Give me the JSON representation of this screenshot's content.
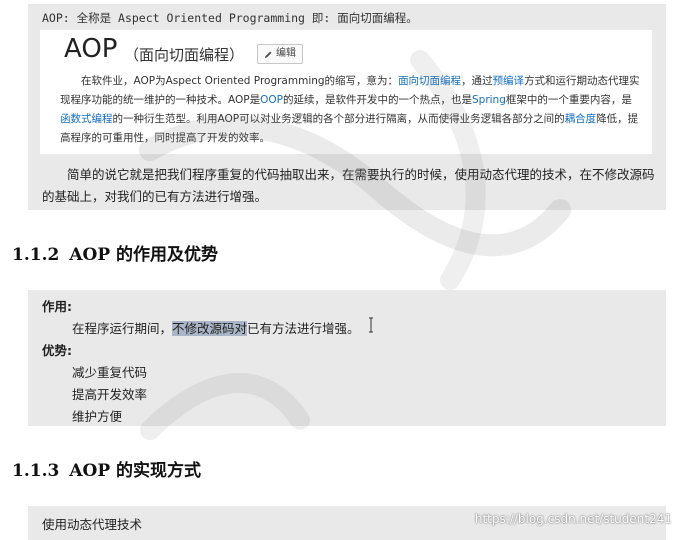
{
  "definition_line": "AOP: 全称是 Aspect Oriented Programming 即: 面向切面编程。",
  "baike": {
    "title": "AOP",
    "subtitle": "（面向切面编程）",
    "edit_label": "编辑",
    "para_parts": [
      {
        "t": "在软件业，AOP为Aspect Oriented Programming的缩写，意为：",
        "link": false
      },
      {
        "t": "面向切面编程",
        "link": true
      },
      {
        "t": "，通过",
        "link": false
      },
      {
        "t": "预编译",
        "link": true
      },
      {
        "t": "方式和运行期动态代理实现程序功能的统一维护的一种技术。AOP是",
        "link": false
      },
      {
        "t": "OOP",
        "link": true
      },
      {
        "t": "的延续，是软件开发中的一个热点，也是",
        "link": false
      },
      {
        "t": "Spring",
        "link": true
      },
      {
        "t": "框架中的一个重要内容，是",
        "link": false
      },
      {
        "t": "函数式编程",
        "link": true
      },
      {
        "t": "的一种衍生范型。利用AOP可以对业务逻辑的各个部分进行隔离，从而使得业务逻辑各部分之间的",
        "link": false
      },
      {
        "t": "耦合度",
        "link": true
      },
      {
        "t": "降低，提高程序的可重用性，同时提高了开发的效率。",
        "link": false
      }
    ]
  },
  "summary": "简单的说它就是把我们程序重复的代码抽取出来，在需要执行的时候，使用动态代理的技术，在不修改源码的基础上，对我们的已有方法进行增强。",
  "section2": {
    "number": "1.1.2",
    "title": "AOP 的作用及优势",
    "role_label": "作用:",
    "role_pre": "在程序运行期间，",
    "role_highlight": "不修改源码对",
    "role_post": "已有方法进行增强。",
    "adv_label": "优势:",
    "advantages": [
      "减少重复代码",
      "提高开发效率",
      "维护方便"
    ]
  },
  "section3": {
    "number": "1.1.3",
    "title": "AOP 的实现方式",
    "text": "使用动态代理技术"
  },
  "watermark": "https://blog.csdn.net/student241"
}
